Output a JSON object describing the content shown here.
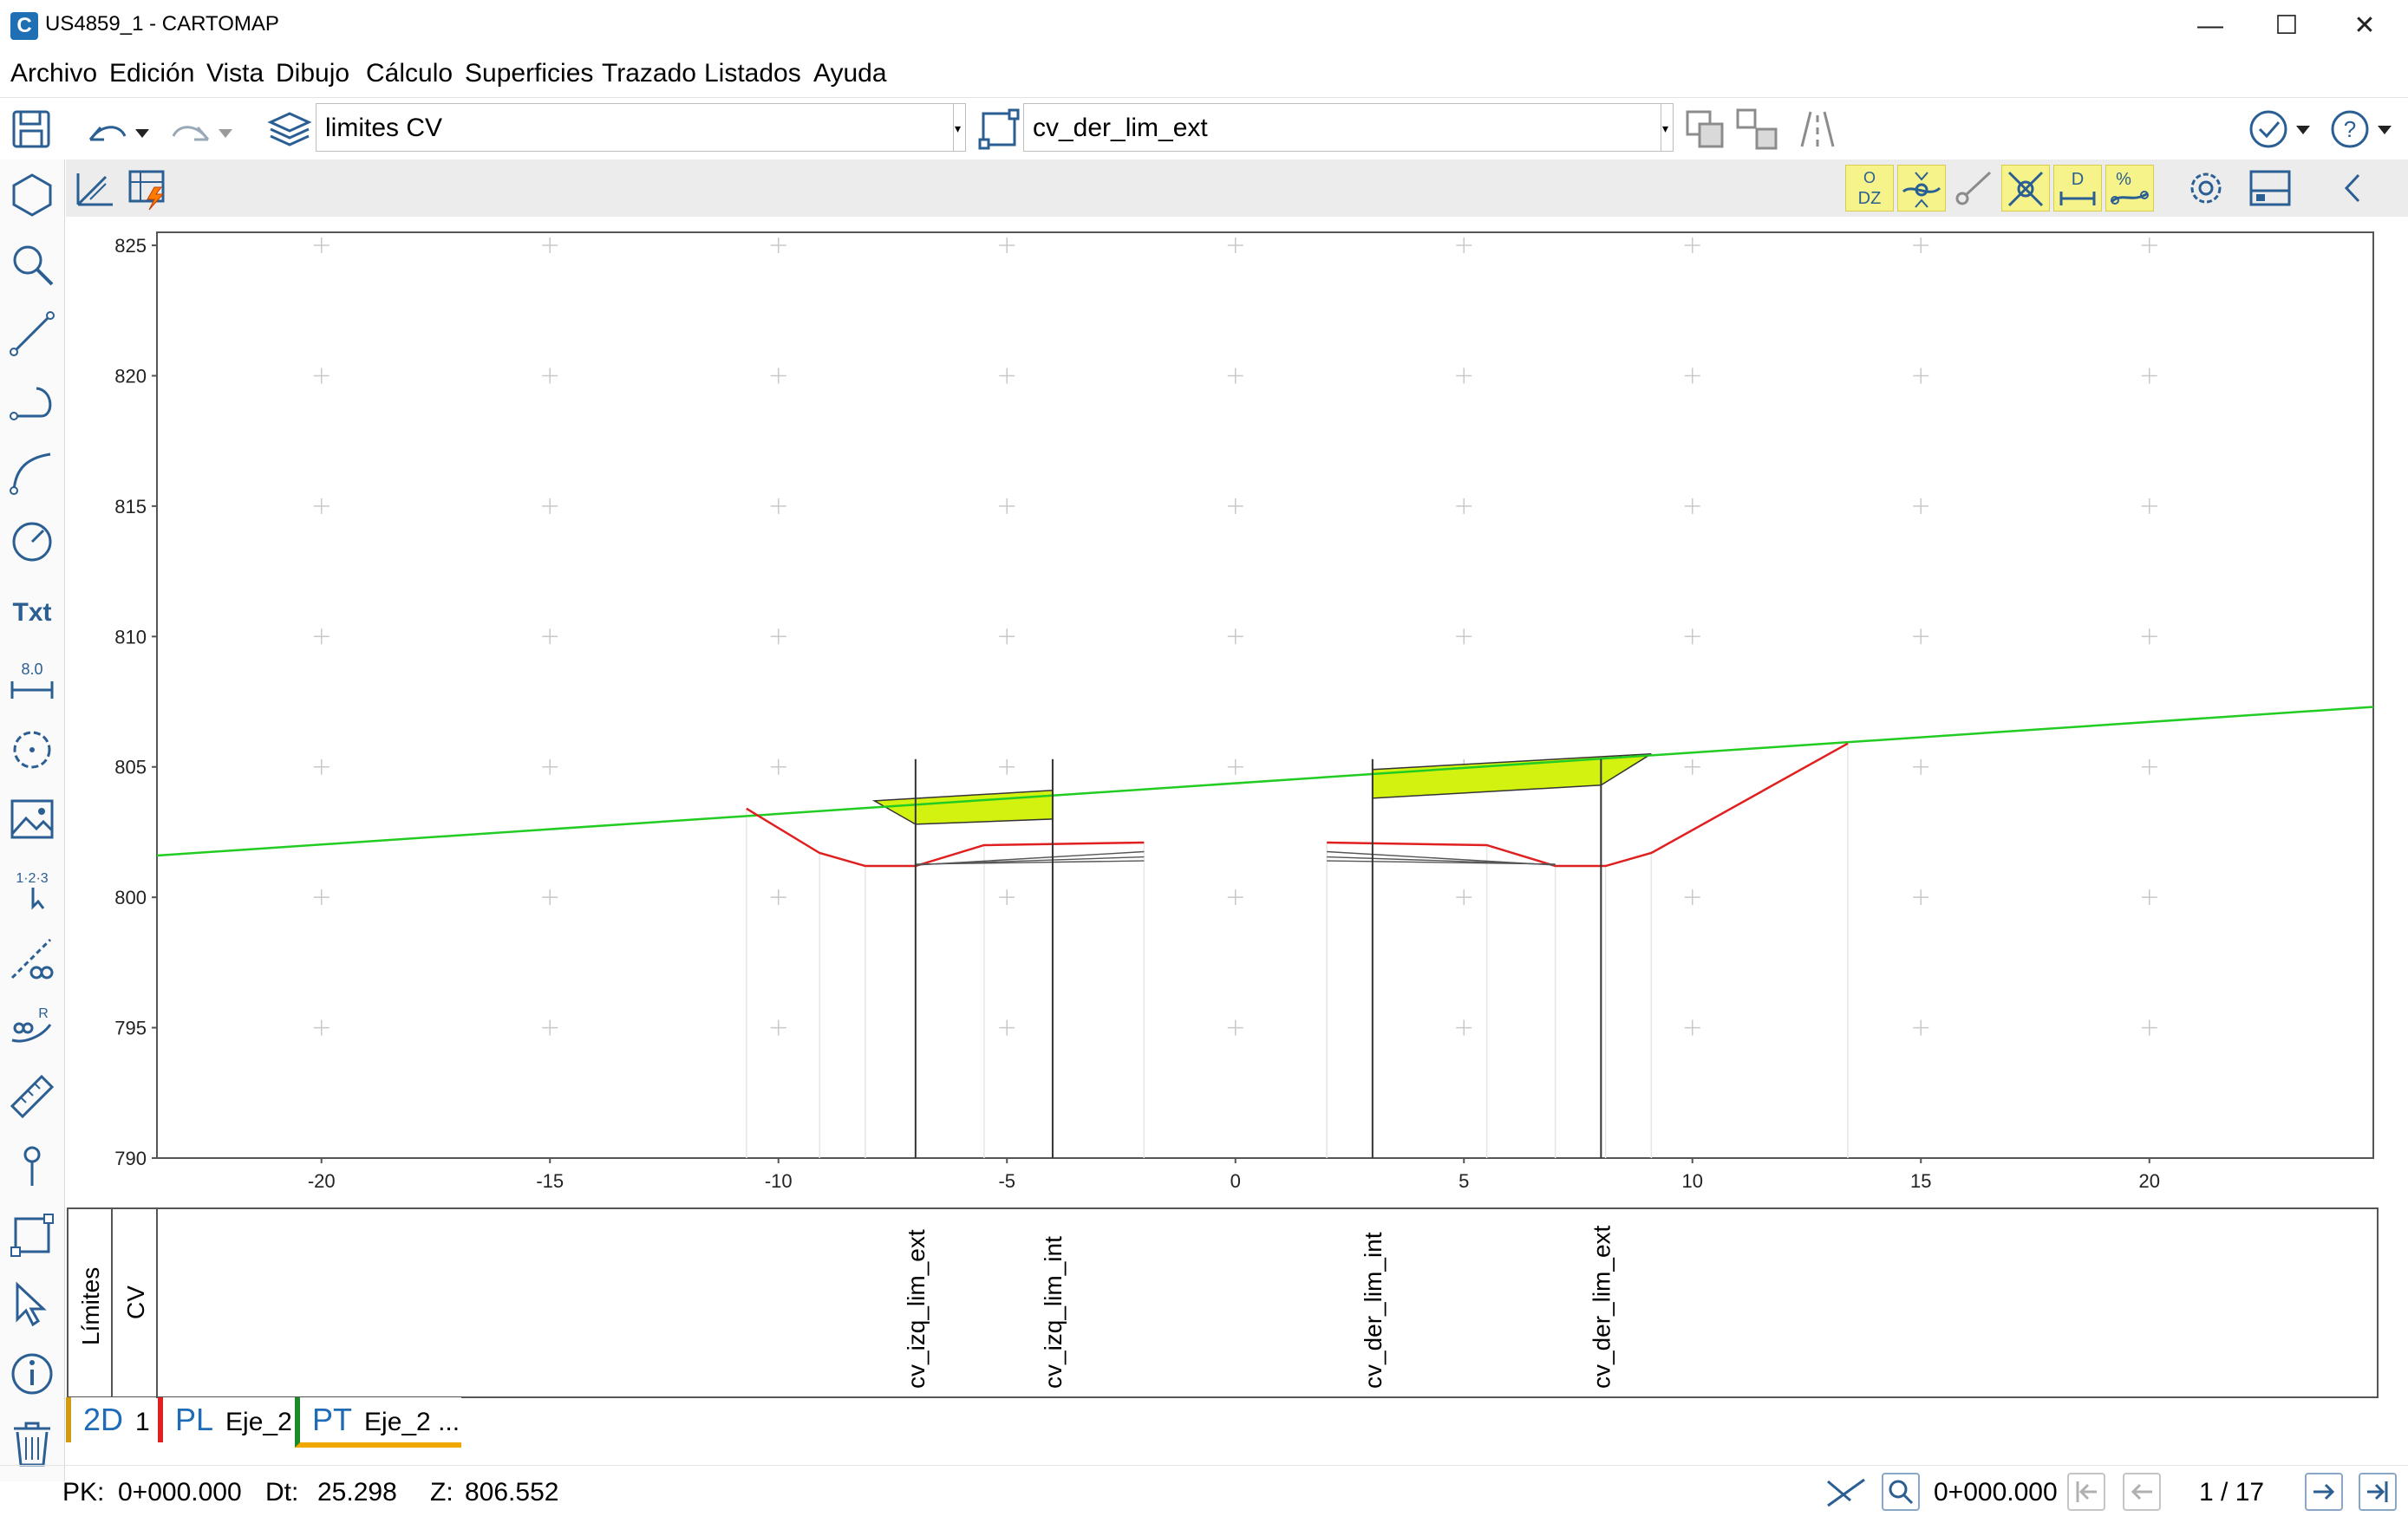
{
  "window": {
    "title": "US4859_1 - CARTOMAP",
    "app_glyph": "C",
    "minimize": "—",
    "maximize": "☐",
    "close": "✕"
  },
  "menu": [
    "Archivo",
    "Edición",
    "Vista",
    "Dibujo",
    "Cálculo",
    "Superficies",
    "Trazado",
    "Listados",
    "Ayuda"
  ],
  "toolbar": {
    "layer_combo": "limites CV",
    "object_combo": "cv_der_lim_ext",
    "icons": [
      "save-icon",
      "undo-icon",
      "redo-icon",
      "layers-icon",
      "polyline-icon",
      "copy-icon",
      "move-icon",
      "road-icon",
      "check-icon",
      "help-icon"
    ]
  },
  "left_tools": {
    "icons": [
      "polygon-icon",
      "zoom-icon",
      "line-icon",
      "curve-icon",
      "arc-icon",
      "circle-icon",
      "text-icon",
      "dimension-icon",
      "cloud-icon",
      "image-icon",
      "numbering-icon",
      "parallel-icon",
      "radius-icon",
      "measure-icon",
      "point-icon",
      "rectangle-icon",
      "select-icon",
      "info-icon",
      "delete-icon"
    ],
    "text_tool_label": "Txt",
    "dimension_label": "8.0",
    "numbering_label": "1·2·3",
    "radius_label": "R"
  },
  "toolbar2": {
    "snaps": [
      {
        "name": "snap-dz-icon",
        "label": "DZ",
        "sup": "O"
      },
      {
        "name": "snap-node-icon",
        "label": ""
      },
      {
        "name": "snap-endpoint-icon",
        "label": ""
      },
      {
        "name": "snap-intersection-icon",
        "label": ""
      },
      {
        "name": "snap-distance-icon",
        "label": "D"
      },
      {
        "name": "snap-percent-icon",
        "label": "%"
      }
    ]
  },
  "chart_data": {
    "type": "line",
    "title": "",
    "xlabel": "",
    "ylabel": "",
    "xlim": [
      -23.6,
      24.9
    ],
    "ylim": [
      790,
      825.5
    ],
    "x_ticks": [
      -20,
      -15,
      -10,
      -5,
      0,
      5,
      10,
      15,
      20
    ],
    "y_ticks": [
      790,
      795,
      800,
      805,
      810,
      815,
      820,
      825
    ],
    "grid": "crosses",
    "series": [
      {
        "color": "#22cc22",
        "kind": "terrain",
        "points": [
          [
            -23.6,
            801.6
          ],
          [
            24.9,
            807.3
          ]
        ]
      },
      {
        "color": "#e02020",
        "kind": "section-left",
        "points": [
          [
            -10.7,
            803.4
          ],
          [
            -9.1,
            801.7
          ],
          [
            -8.1,
            801.2
          ],
          [
            -7.0,
            801.2
          ],
          [
            -5.5,
            802.0
          ],
          [
            -2.0,
            802.1
          ]
        ]
      },
      {
        "color": "#e02020",
        "kind": "section-right",
        "points": [
          [
            2.0,
            802.1
          ],
          [
            5.5,
            802.0
          ],
          [
            7.0,
            801.2
          ],
          [
            8.1,
            801.2
          ],
          [
            9.1,
            801.7
          ],
          [
            13.4,
            805.9
          ]
        ]
      }
    ],
    "fills": [
      {
        "color": "#d4f20f",
        "points": [
          [
            -7.9,
            803.7
          ],
          [
            -4.0,
            804.1
          ],
          [
            -4.0,
            803.0
          ],
          [
            -7.0,
            802.8
          ]
        ]
      },
      {
        "color": "#d4f20f",
        "points": [
          [
            3.0,
            804.9
          ],
          [
            9.1,
            805.5
          ],
          [
            8.0,
            804.3
          ],
          [
            3.0,
            803.8
          ]
        ]
      }
    ],
    "limit_lines": [
      {
        "x": -7.0,
        "label": "cv_izq_lim_ext"
      },
      {
        "x": -4.0,
        "label": "cv_izq_lim_int"
      },
      {
        "x": 3.0,
        "label": "cv_der_lim_int"
      },
      {
        "x": 8.0,
        "label": "cv_der_lim_ext"
      }
    ]
  },
  "band": {
    "header_1": "Límites",
    "header_2": "CV"
  },
  "tabs": [
    {
      "key": "2D",
      "label": "1",
      "color": "#d49a12"
    },
    {
      "key": "PL",
      "label": "Eje_2",
      "color": "#e02020"
    },
    {
      "key": "PT",
      "label": "Eje_2 ...",
      "color": "#1a8a2a"
    }
  ],
  "status": {
    "pk_label": "PK:",
    "pk_value": "0+000.000",
    "dt_label": "Dt:",
    "dt_value": "25.298",
    "z_label": "Z:",
    "z_value": "806.552",
    "pk_nav_value": "0+000.000",
    "page": "1 / 17"
  }
}
